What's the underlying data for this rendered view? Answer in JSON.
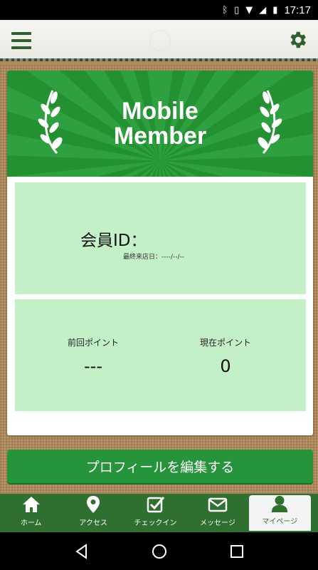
{
  "status_bar": {
    "time": "17:17"
  },
  "header": {
    "menu_icon": "hamburger-menu-icon",
    "settings_icon": "gear-icon"
  },
  "banner": {
    "title": "Mobile Member"
  },
  "member": {
    "id_label": "会員ID：",
    "last_visit": "最終来店日：----/--/--"
  },
  "points": {
    "previous_label": "前回ポイント",
    "previous_value": "---",
    "current_label": "現在ポイント",
    "current_value": "0"
  },
  "edit_button": {
    "label": "プロフィールを編集する"
  },
  "tabs": [
    {
      "label": "ホーム",
      "icon": "home-icon"
    },
    {
      "label": "アクセス",
      "icon": "map-pin-icon"
    },
    {
      "label": "チェックイン",
      "icon": "checkbox-icon"
    },
    {
      "label": "メッセージ",
      "icon": "mail-icon"
    },
    {
      "label": "マイページ",
      "icon": "user-icon",
      "active": true
    }
  ],
  "colors": {
    "brand_green": "#26943a",
    "panel_green": "#c4f0c8",
    "tab_bar": "#2f6f2f"
  }
}
